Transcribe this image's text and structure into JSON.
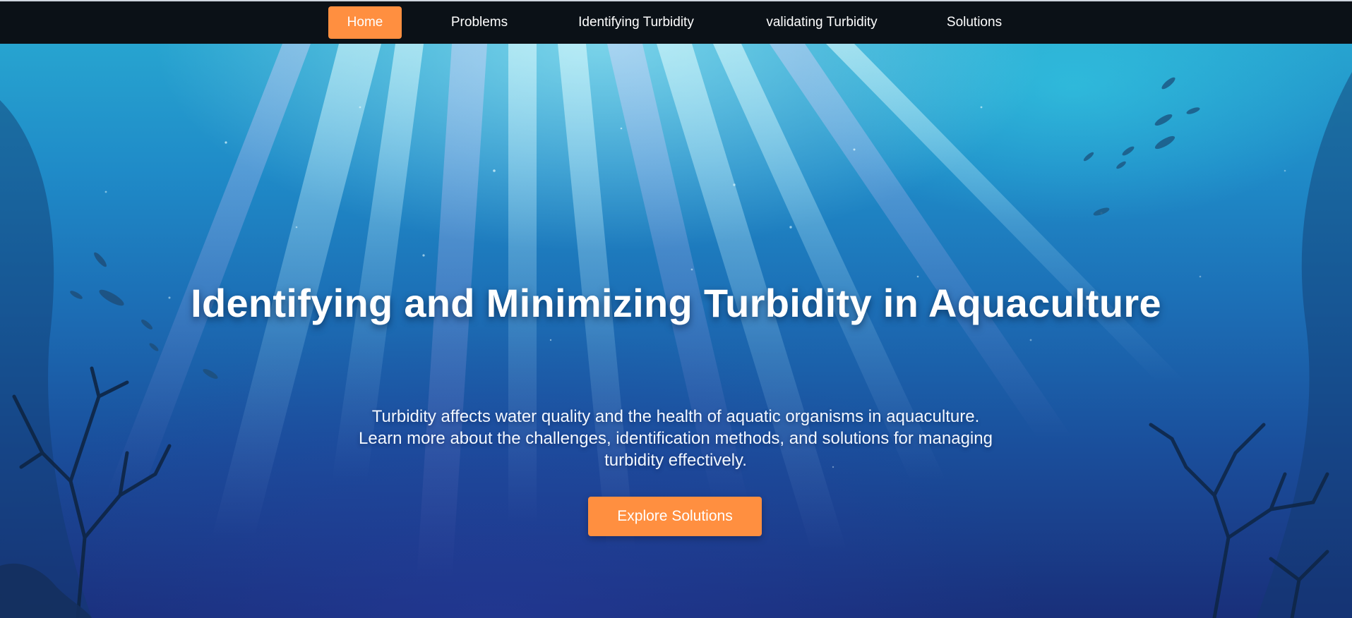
{
  "nav": {
    "items": [
      {
        "label": "Home",
        "active": true
      },
      {
        "label": "Problems",
        "active": false
      },
      {
        "label": "Identifying Turbidity",
        "active": false
      },
      {
        "label": "validating Turbidity",
        "active": false
      },
      {
        "label": "Solutions",
        "active": false
      }
    ]
  },
  "hero": {
    "title": "Identifying and Minimizing Turbidity in Aquaculture",
    "text": "Turbidity affects water quality and the health of aquatic organisms in aquaculture. Learn more about the challenges, identification methods, and solutions for managing turbidity effectively.",
    "cta_label": "Explore Solutions"
  },
  "colors": {
    "accent": "#ff8f40",
    "navbar": "#0b1117",
    "text": "#ffffff"
  }
}
